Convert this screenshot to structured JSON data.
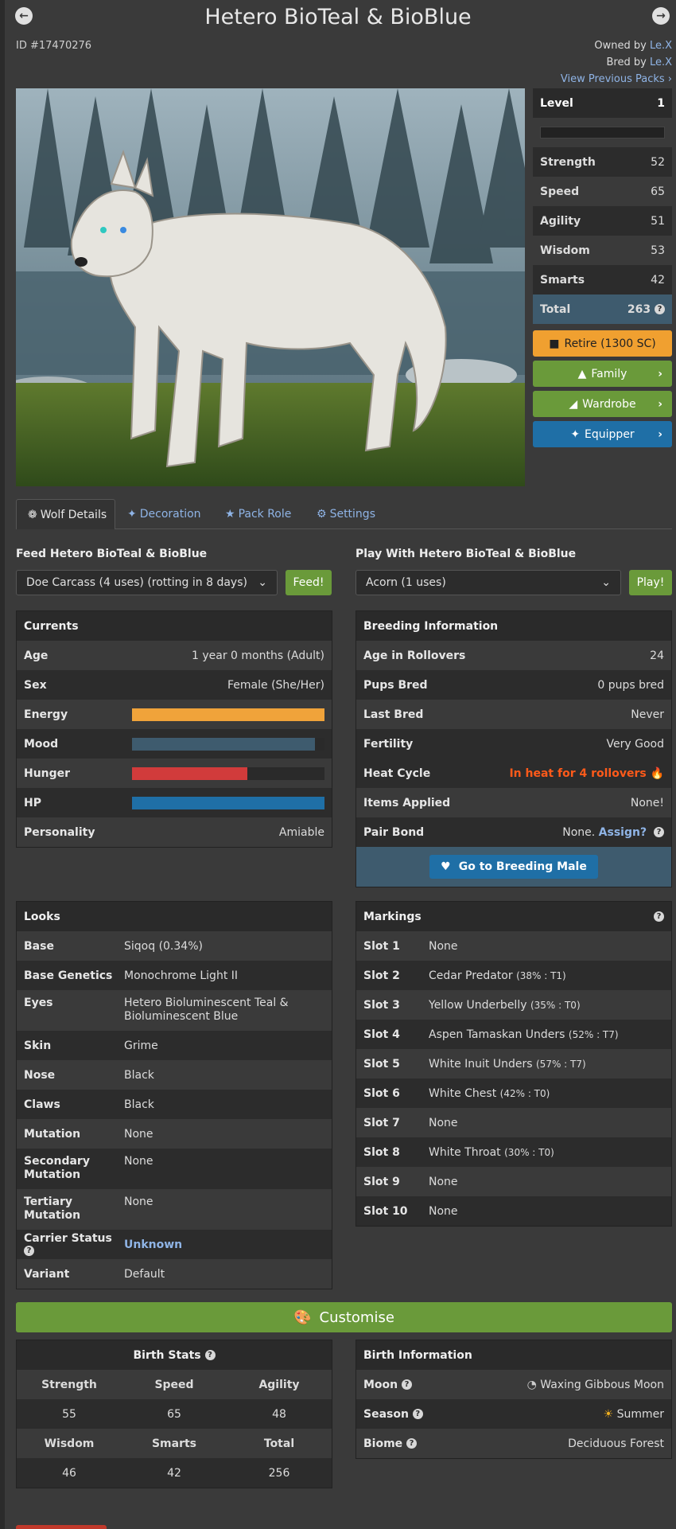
{
  "header": {
    "title": "Hetero BioTeal & BioBlue",
    "id_label": "ID #17470276",
    "owned_prefix": "Owned by ",
    "owner": "Le.X",
    "bred_prefix": "Bred by ",
    "breeder": "Le.X",
    "view_previous": "View Previous Packs"
  },
  "stats": {
    "level_label": "Level",
    "level": "1",
    "xp_progress": 0,
    "rows": [
      {
        "label": "Strength",
        "value": "52"
      },
      {
        "label": "Speed",
        "value": "65"
      },
      {
        "label": "Agility",
        "value": "51"
      },
      {
        "label": "Wisdom",
        "value": "53"
      },
      {
        "label": "Smarts",
        "value": "42"
      }
    ],
    "total_label": "Total",
    "total": "263"
  },
  "actions": {
    "retire": "Retire (1300 SC)",
    "family": "Family",
    "wardrobe": "Wardrobe",
    "equipper": "Equipper"
  },
  "tabs": [
    "Wolf Details",
    "Decoration",
    "Pack Role",
    "Settings"
  ],
  "feed": {
    "title": "Feed Hetero BioTeal & BioBlue",
    "selected": "Doe Carcass (4 uses) (rotting in 8 days)",
    "button": "Feed!"
  },
  "play": {
    "title": "Play With Hetero BioTeal & BioBlue",
    "selected": "Acorn (1 uses)",
    "button": "Play!"
  },
  "currents": {
    "title": "Currents",
    "age_label": "Age",
    "age": "1 year 0 months (Adult)",
    "sex_label": "Sex",
    "sex": "Female (She/Her)",
    "energy_label": "Energy",
    "energy": 1.0,
    "mood_label": "Mood",
    "mood": 0.95,
    "hunger_label": "Hunger",
    "hunger": 0.6,
    "hp_label": "HP",
    "hp": 1.0,
    "personality_label": "Personality",
    "personality": "Amiable"
  },
  "breeding": {
    "title": "Breeding Information",
    "rows": [
      {
        "label": "Age in Rollovers",
        "value": "24"
      },
      {
        "label": "Pups Bred",
        "value": "0 pups bred"
      },
      {
        "label": "Last Bred",
        "value": "Never"
      },
      {
        "label": "Fertility",
        "value": "Very Good"
      }
    ],
    "heat_label": "Heat Cycle",
    "heat": "In heat for 4 rollovers",
    "items_label": "Items Applied",
    "items": "None!",
    "pair_label": "Pair Bond",
    "pair_value": "None.",
    "assign": "Assign?",
    "goto": "Go to Breeding Male"
  },
  "looks": {
    "title": "Looks",
    "rows": [
      {
        "label": "Base",
        "value": "Siqoq (0.34%)"
      },
      {
        "label": "Base Genetics",
        "value": "Monochrome Light II"
      },
      {
        "label": "Eyes",
        "value": "Hetero Bioluminescent Teal & Bioluminescent Blue"
      },
      {
        "label": "Skin",
        "value": "Grime"
      },
      {
        "label": "Nose",
        "value": "Black"
      },
      {
        "label": "Claws",
        "value": "Black"
      },
      {
        "label": "Mutation",
        "value": "None"
      },
      {
        "label": "Secondary Mutation",
        "value": "None"
      },
      {
        "label": "Tertiary Mutation",
        "value": "None"
      }
    ],
    "carrier_label": "Carrier Status",
    "carrier": "Unknown",
    "variant_label": "Variant",
    "variant": "Default"
  },
  "markings": {
    "title": "Markings",
    "slots": [
      {
        "label": "Slot 1",
        "name": "None",
        "pct": ""
      },
      {
        "label": "Slot 2",
        "name": "Cedar Predator",
        "pct": "(38% : T1)"
      },
      {
        "label": "Slot 3",
        "name": "Yellow Underbelly",
        "pct": "(35% : T0)"
      },
      {
        "label": "Slot 4",
        "name": "Aspen Tamaskan Unders",
        "pct": "(52% : T7)"
      },
      {
        "label": "Slot 5",
        "name": "White Inuit Unders",
        "pct": "(57% : T7)"
      },
      {
        "label": "Slot 6",
        "name": "White Chest",
        "pct": "(42% : T0)"
      },
      {
        "label": "Slot 7",
        "name": "None",
        "pct": ""
      },
      {
        "label": "Slot 8",
        "name": "White Throat",
        "pct": "(30% : T0)"
      },
      {
        "label": "Slot 9",
        "name": "None",
        "pct": ""
      },
      {
        "label": "Slot 10",
        "name": "None",
        "pct": ""
      }
    ]
  },
  "customise": "Customise",
  "birth_stats": {
    "title": "Birth Stats",
    "h1": [
      "Strength",
      "Speed",
      "Agility"
    ],
    "v1": [
      "55",
      "65",
      "48"
    ],
    "h2": [
      "Wisdom",
      "Smarts",
      "Total"
    ],
    "v2": [
      "46",
      "42",
      "256"
    ]
  },
  "birth_info": {
    "title": "Birth Information",
    "moon_label": "Moon",
    "moon": "Waxing Gibbous Moon",
    "season_label": "Season",
    "season": "Summer",
    "biome_label": "Biome",
    "biome": "Deciduous Forest"
  },
  "colors": {
    "retire": "#f0a030",
    "green": "#6a9a3a",
    "blue": "#1f6fa6",
    "total_bg": "#3e5b6e",
    "energy": "#f0a33a",
    "mood": "#3e5b6e",
    "hunger": "#d13b3b",
    "hp": "#1f6fa6",
    "heat": "#ff5a1a"
  },
  "icons": [
    "back-arrow-icon",
    "forward-arrow-icon",
    "paw-icon",
    "feather-icon",
    "star-icon",
    "gear-icon",
    "tree-icon",
    "shirt-icon",
    "sparkle-icon",
    "heart-icon",
    "palette-icon",
    "flame-icon",
    "moon-icon",
    "sun-icon",
    "question-icon",
    "chevron-down-icon"
  ]
}
